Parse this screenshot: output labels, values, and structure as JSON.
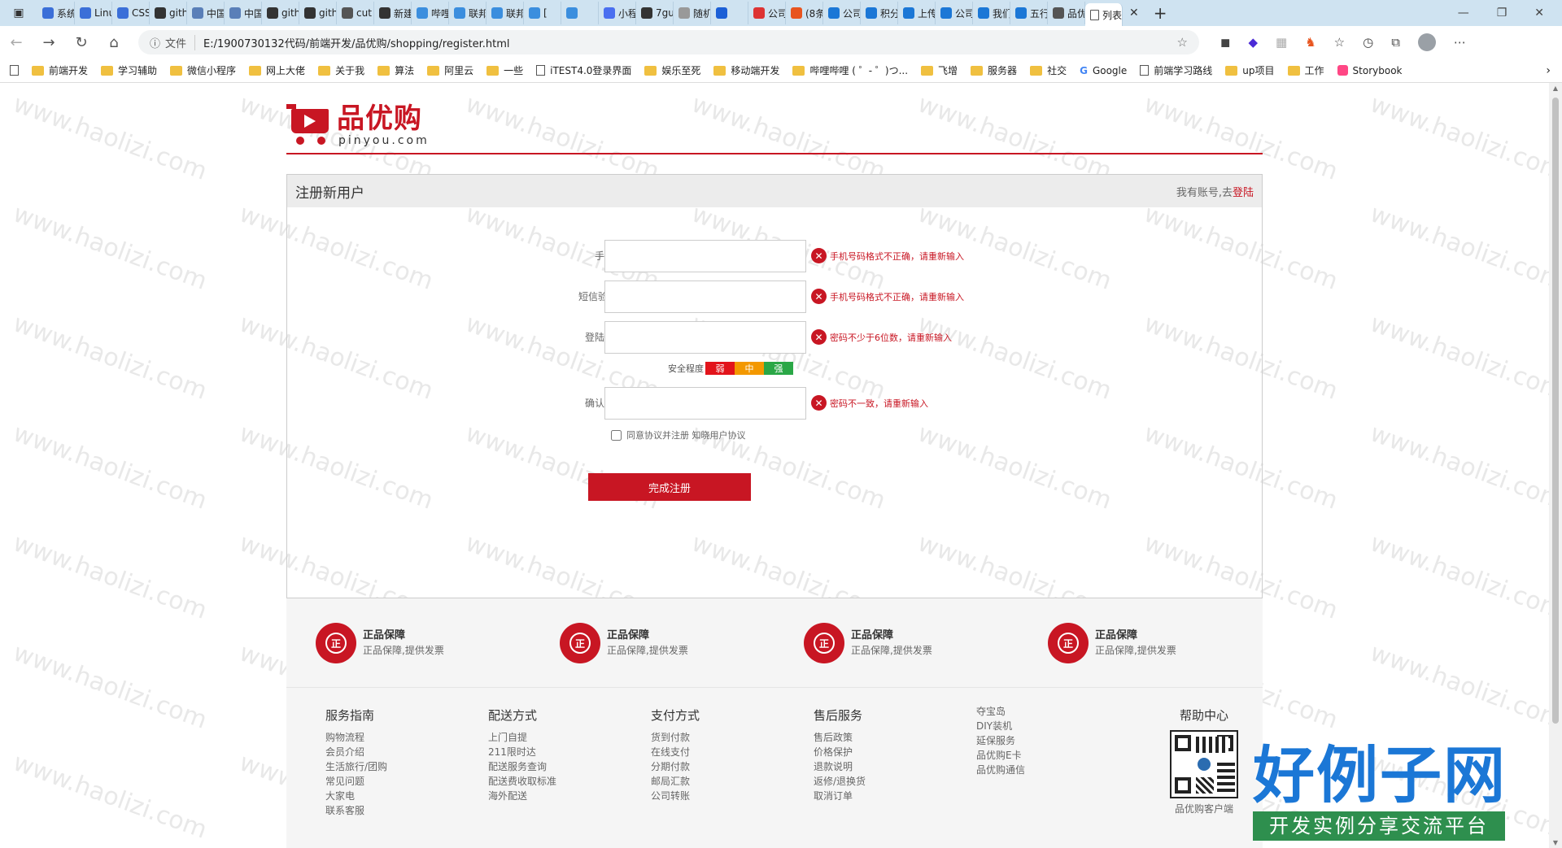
{
  "browser": {
    "tabs": [
      "系统",
      "Linu",
      "CSS",
      "gith",
      "中国",
      "中国",
      "gith",
      "gith",
      "cut",
      "新建",
      "哔哩",
      "联邦",
      "联邦",
      "[",
      "",
      "小程",
      "7gu",
      "随机",
      "",
      "公司",
      "(8条",
      "公司",
      "积分",
      "上传",
      "公司",
      "我们",
      "五行",
      "品优",
      "列表"
    ],
    "active_tab_label": "列表",
    "address_scheme": "文件",
    "address_url": "E:/1900730132代码/前端开发/品优购/shopping/register.html",
    "bookmarks": [
      "前端开发",
      "学习辅助",
      "微信小程序",
      "网上大佬",
      "关于我",
      "算法",
      "阿里云",
      "一些",
      "iTEST4.0登录界面",
      "娱乐至死",
      "移动端开发",
      "哔哩哔哩 ( ゜- ゜)つ...",
      "飞增",
      "服务器",
      "社交",
      "Google",
      "前端学习路线",
      "up项目",
      "工作",
      "Storybook"
    ]
  },
  "logo": {
    "cn": "品优购",
    "en": "pinyou.com"
  },
  "register": {
    "title": "注册新用户",
    "login_prompt": "我有账号,去",
    "login_link": "登陆",
    "fields": [
      {
        "label": "手机号:",
        "value": "",
        "error": "手机号码格式不正确，请重新输入"
      },
      {
        "label": "短信验证码",
        "value": "",
        "error": "手机号码格式不正确，请重新输入"
      },
      {
        "label": "登陆密码:",
        "value": "",
        "error": "密码不少于6位数，请重新输入"
      },
      {
        "label": "确认密码:",
        "value": "",
        "error": "密码不一致，请重新输入"
      }
    ],
    "strength_label": "安全程度",
    "strength_levels": [
      "弱",
      "中",
      "强"
    ],
    "agree_text": "同意协议并注册 知晓用户协议",
    "agree_checked": false,
    "submit_label": "完成注册"
  },
  "services": [
    {
      "icon": "正",
      "title": "正品保障",
      "desc": "正品保障,提供发票"
    },
    {
      "icon": "正",
      "title": "正品保障",
      "desc": "正品保障,提供发票"
    },
    {
      "icon": "正",
      "title": "正品保障",
      "desc": "正品保障,提供发票"
    },
    {
      "icon": "正",
      "title": "正品保障",
      "desc": "正品保障,提供发票"
    }
  ],
  "help": {
    "columns": [
      {
        "title": "服务指南",
        "items": [
          "购物流程",
          "会员介绍",
          "生活旅行/团购",
          "常见问题",
          "大家电",
          "联系客服"
        ]
      },
      {
        "title": "配送方式",
        "items": [
          "上门自提",
          "211限时达",
          "配送服务查询",
          "配送费收取标准",
          "海外配送"
        ]
      },
      {
        "title": "支付方式",
        "items": [
          "货到付款",
          "在线支付",
          "分期付款",
          "邮局汇款",
          "公司转账"
        ]
      },
      {
        "title": "售后服务",
        "items": [
          "售后政策",
          "价格保护",
          "退款说明",
          "返修/退换货",
          "取消订单"
        ]
      },
      {
        "title": "",
        "items": [
          "夺宝岛",
          "DIY装机",
          "延保服务",
          "品优购E卡",
          "品优购通信"
        ]
      }
    ],
    "center_title": "帮助中心",
    "qr_caption": "品优购客户端"
  },
  "watermark": "www.haolizi.com",
  "brand": {
    "cn": "好例子网",
    "sub": "开发实例分享交流平台"
  },
  "colors": {
    "brand_red": "#c81623",
    "weak": "#e2141b",
    "mid": "#f39800",
    "strong": "#2aa746"
  }
}
